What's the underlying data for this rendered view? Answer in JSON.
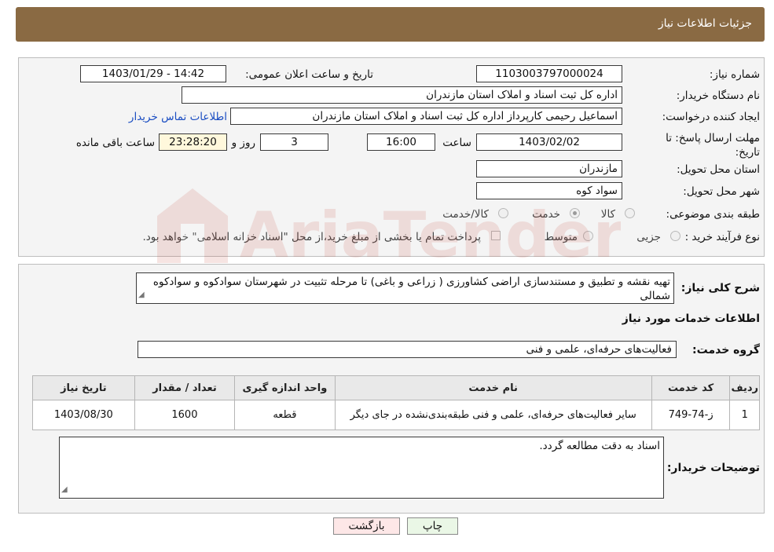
{
  "header": {
    "title": "جزئیات اطلاعات نیاز"
  },
  "form": {
    "need_number_label": "شماره نیاز:",
    "need_number": "1103003797000024",
    "announce_label": "تاریخ و ساعت اعلان عمومی:",
    "announce_value": "1403/01/29 - 14:42",
    "buyer_org_label": "نام دستگاه خریدار:",
    "buyer_org": "اداره کل ثبت اسناد و املاک استان مازندران",
    "creator_label": "ایجاد کننده درخواست:",
    "creator": "اسماعیل رحیمی کارپرداز اداره کل ثبت اسناد و املاک استان مازندران",
    "contact_link": "اطلاعات تماس خریدار",
    "deadline_label": "مهلت ارسال پاسخ: تا تاریخ:",
    "deadline_date": "1403/02/02",
    "hour_label": "ساعت",
    "deadline_time": "16:00",
    "days_value": "3",
    "days_label": "روز و",
    "remaining_time": "23:28:20",
    "remaining_label": "ساعت باقی مانده",
    "province_label": "استان محل تحویل:",
    "province": "مازندران",
    "city_label": "شهر محل تحویل:",
    "city": "سواد کوه",
    "category_label": "طبقه بندی موضوعی:",
    "category_options": [
      "کالا",
      "خدمت",
      "کالا/خدمت"
    ],
    "process_label": "نوع فرآیند خرید :",
    "process_options": [
      "جزیی",
      "متوسط"
    ],
    "payment_note": "پرداخت تمام یا بخشی از مبلغ خرید،از محل \"اسناد خزانه اسلامی\" خواهد بود."
  },
  "description": {
    "label": "شرح کلی نیاز:",
    "text": "تهیه نقشه و تطبیق و مستندسازی اراضی کشاورزی ( زراعی و باغی) تا مرحله تثبیت در شهرستان سوادکوه و سوادکوه شمالی"
  },
  "services": {
    "section_title": "اطلاعات خدمات مورد نیاز",
    "group_label": "گروه خدمت:",
    "group_value": "فعالیت‌های حرفه‌ای، علمی و فنی",
    "columns": [
      "ردیف",
      "کد خدمت",
      "نام خدمت",
      "واحد اندازه گیری",
      "تعداد / مقدار",
      "تاریخ نیاز"
    ],
    "rows": [
      [
        "1",
        "ز-74-749",
        "سایر فعالیت‌های حرفه‌ای، علمی و فنی طبقه‌بندی‌نشده در جای دیگر",
        "قطعه",
        "1600",
        "1403/08/30"
      ]
    ]
  },
  "buyer_notes": {
    "label": "توضیحات خریدار:",
    "text": "اسناد به دقت مطالعه گردد."
  },
  "buttons": {
    "print": "چاپ",
    "back": "بازگشت"
  },
  "colors": {
    "header_bg": "#8a6a43",
    "print_btn": "#eaf7e6",
    "back_btn": "#fde7e7",
    "link": "#1a4dc2"
  }
}
